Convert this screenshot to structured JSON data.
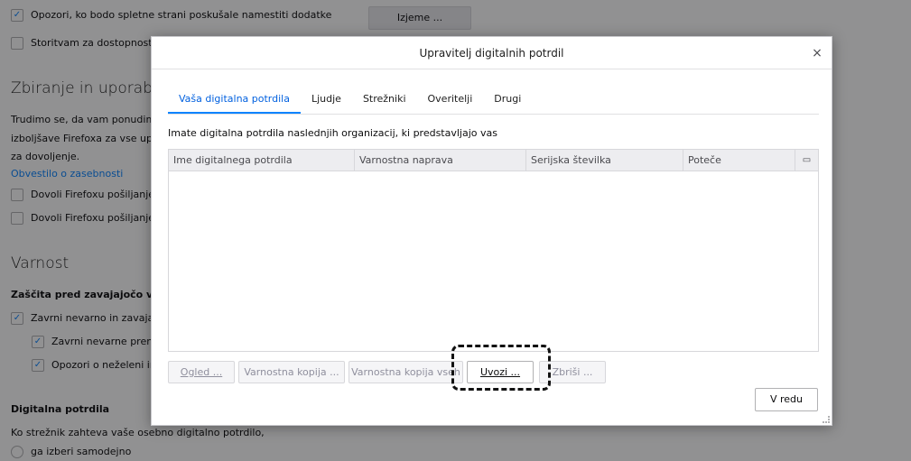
{
  "background": {
    "addon_warning": {
      "label": "Opozori, ko bodo spletne strani poskušale namestiti dodatke",
      "checked": true
    },
    "exceptions_button": "Izjeme ...",
    "accessibility_option": "Storitvam za dostopnost p",
    "data_section_title": "Zbiranje in uporaba p",
    "data_text_1": "Trudimo se, da vam ponudimo",
    "data_text_2": "izboljšave Firefoxa za vse upor",
    "data_text_3": "za dovoljenje.",
    "privacy_link": "Obvestilo o zasebnosti",
    "allow_1": "Dovoli Firefoxu pošiljanje",
    "allow_2": "Dovoli Firefoxu pošiljanje",
    "security_title": "Varnost",
    "deceptive_title": "Zaščita pred zavajajočo vs",
    "block_1": "Zavrni nevarno in zavajajo",
    "block_2": "Zavrni nevarne prenos",
    "block_3": "Opozori o neželeni in",
    "certs_title": "Digitalna potrdila",
    "certs_text": "Ko strežnik zahteva vaše osebno digitalno potrdilo,",
    "auto_select": "ga izberi samodejno"
  },
  "dialog": {
    "title": "Upravitelj digitalnih potrdil",
    "close_label": "×",
    "tabs": [
      {
        "label": "Vaša digitalna potrdila",
        "active": true
      },
      {
        "label": "Ljudje",
        "active": false
      },
      {
        "label": "Strežniki",
        "active": false
      },
      {
        "label": "Overitelji",
        "active": false
      },
      {
        "label": "Drugi",
        "active": false
      }
    ],
    "description": "Imate digitalna potrdila naslednjih organizacij, ki predstavljajo vas",
    "columns": [
      "Ime digitalnega potrdila",
      "Varnostna naprava",
      "Serijska številka",
      "Poteče"
    ],
    "column_picker_icon": "column-picker-icon",
    "buttons": {
      "view": "Ogled ...",
      "backup": "Varnostna kopija ...",
      "backup_all": "Varnostna kopija vseh",
      "import": "Uvozi ...",
      "delete": "Zbriši ...",
      "ok": "V redu"
    }
  },
  "colors": {
    "accent": "#0a84ff",
    "highlight_border": "#111111"
  }
}
